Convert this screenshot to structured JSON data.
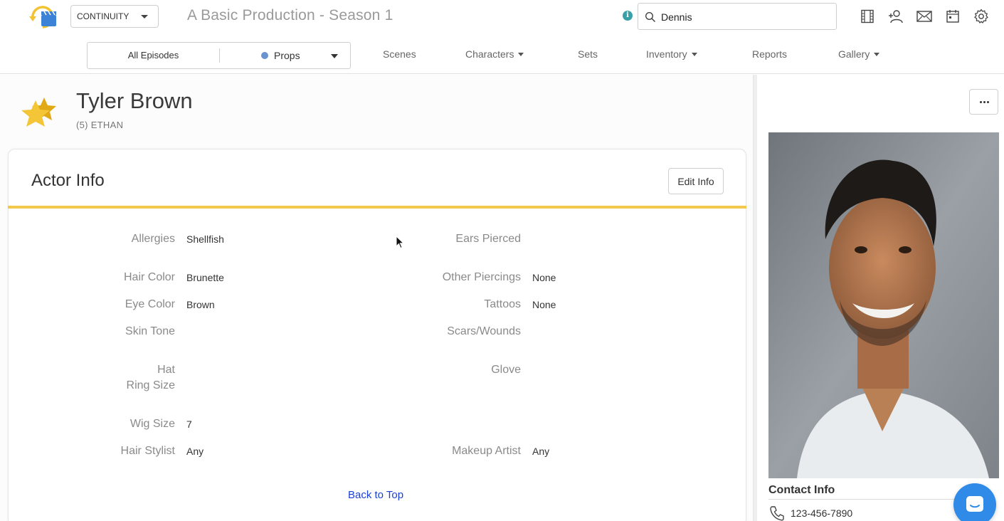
{
  "app": {
    "module_select": "CONTINUITY",
    "production_title": "A Basic Production - Season 1",
    "info_glyph": "i"
  },
  "search": {
    "value": "Dennis",
    "placeholder": "Search"
  },
  "top_icons": [
    "film-strip-icon",
    "add-person-icon",
    "mail-icon",
    "calendar-icon",
    "settings-gear-icon"
  ],
  "filter": {
    "episodes": "All Episodes",
    "department": "Props",
    "department_color": "#6a94cf"
  },
  "nav": {
    "scenes": "Scenes",
    "characters": "Characters",
    "sets": "Sets",
    "inventory": "Inventory",
    "reports": "Reports",
    "gallery": "Gallery"
  },
  "actor": {
    "name": "Tyler Brown",
    "role": "(5) ETHAN",
    "star_color": "#f2c230"
  },
  "card": {
    "title": "Actor Info",
    "edit_label": "Edit Info",
    "accent_color": "#f2c94c",
    "left_fields": [
      {
        "label": "Allergies",
        "value": "Shellfish"
      },
      {
        "label": "Hair Color",
        "value": "Brunette"
      },
      {
        "label": "Eye Color",
        "value": "Brown"
      },
      {
        "label": "Skin Tone",
        "value": ""
      },
      {
        "label": "Hat",
        "value": ""
      },
      {
        "label": "Ring Size",
        "value": ""
      },
      {
        "label": "Wig Size",
        "value": "7"
      },
      {
        "label": "Hair Stylist",
        "value": "Any"
      }
    ],
    "right_fields": [
      {
        "label": "Ears Pierced",
        "value": ""
      },
      {
        "label": "Other Piercings",
        "value": "None"
      },
      {
        "label": "Tattoos",
        "value": "None"
      },
      {
        "label": "Scars/Wounds",
        "value": ""
      },
      {
        "label": "Glove",
        "value": ""
      },
      {
        "label": "Makeup Artist",
        "value": "Any"
      }
    ],
    "back_to_top": "Back to Top",
    "link_color": "#1a3fd6"
  },
  "sidebar": {
    "more_label": "More options",
    "contact_title": "Contact Info",
    "phone": "123-456-7890"
  },
  "chat": {
    "color": "#2f8ae8"
  }
}
